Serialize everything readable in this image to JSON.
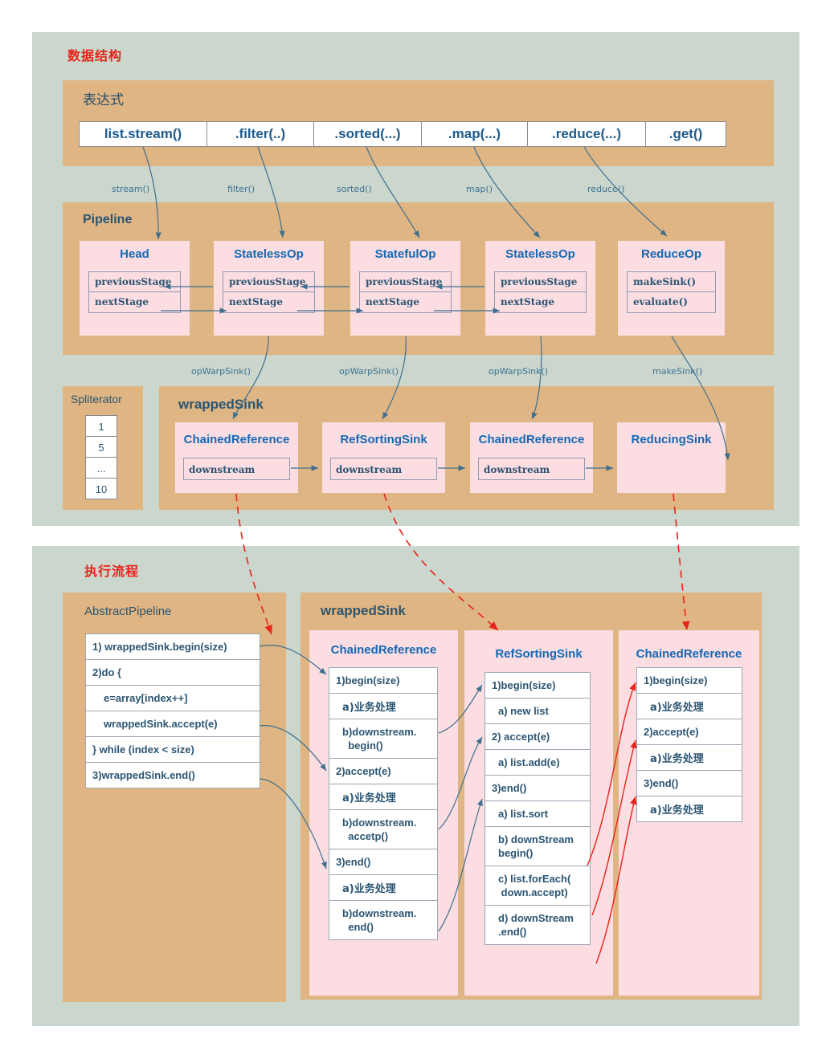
{
  "sections": {
    "data_structure": {
      "title": "数据结构"
    },
    "exec_flow": {
      "title": "执行流程"
    }
  },
  "expression_panel": {
    "title": "表达式",
    "cells": [
      {
        "label": "list.stream()"
      },
      {
        "label": ".filter(..)"
      },
      {
        "label": ".sorted(...)"
      },
      {
        "label": ".map(...)"
      },
      {
        "label": ".reduce(...)"
      },
      {
        "label": ".get()"
      }
    ]
  },
  "connector_labels": {
    "stream": "stream()",
    "filter": "filter()",
    "sorted": "sorted()",
    "map": "map()",
    "reduce": "reduce()",
    "opwrap1": "opWarpSink()",
    "opwrap2": "opWarpSink()",
    "opwrap3": "opWarpSink()",
    "makesink": "makeSink()"
  },
  "pipeline_panel": {
    "title": "Pipeline",
    "stages": [
      {
        "name": "Head",
        "fields": [
          "previousStage",
          "nextStage"
        ]
      },
      {
        "name": "StatelessOp",
        "fields": [
          "previousStage",
          "nextStage"
        ]
      },
      {
        "name": "StatefulOp",
        "fields": [
          "previousStage",
          "nextStage"
        ]
      },
      {
        "name": "StatelessOp",
        "fields": [
          "previousStage",
          "nextStage"
        ]
      },
      {
        "name": "ReduceOp",
        "fields": [
          "makeSink()",
          "evaluate()"
        ]
      }
    ]
  },
  "spliterator_panel": {
    "title": "Spliterator",
    "values": [
      "1",
      "5",
      "...",
      "10"
    ]
  },
  "wrapped_sink_panel": {
    "title": "wrappedSink",
    "sinks": [
      {
        "name": "ChainedReference",
        "field": "downstream"
      },
      {
        "name": "RefSortingSink",
        "field": "downstream"
      },
      {
        "name": "ChainedReference",
        "field": "downstream"
      },
      {
        "name": "ReducingSink",
        "field": ""
      }
    ]
  },
  "abstract_pipeline_panel": {
    "title": "AbstractPipeline",
    "lines": [
      {
        "text": "1) wrappedSink.begin(size)",
        "indent": 0
      },
      {
        "text": "2)do {",
        "indent": 0
      },
      {
        "text": "e=array[index++]",
        "indent": 1
      },
      {
        "text": "wrappedSink.accept(e)",
        "indent": 1
      },
      {
        "text": "} while (index < size)",
        "indent": 0
      },
      {
        "text": "3)wrappedSink.end()",
        "indent": 0
      }
    ]
  },
  "exec_wrapped_sink_panel": {
    "title": "wrappedSink",
    "columns": [
      {
        "name": "ChainedReference",
        "lines": [
          {
            "text": "1)begin(size)",
            "indent": 0,
            "cjk": false,
            "two": false
          },
          {
            "text": "a)业务处理",
            "indent": 1,
            "cjk": true,
            "two": false
          },
          {
            "text": "b)downstream.\n  begin()",
            "indent": 1,
            "cjk": false,
            "two": true
          },
          {
            "text": "2)accept(e)",
            "indent": 0,
            "cjk": false,
            "two": false
          },
          {
            "text": "a)业务处理",
            "indent": 1,
            "cjk": true,
            "two": false
          },
          {
            "text": "b)downstream.\n  accetp()",
            "indent": 1,
            "cjk": false,
            "two": true
          },
          {
            "text": "3)end()",
            "indent": 0,
            "cjk": false,
            "two": false
          },
          {
            "text": "a)业务处理",
            "indent": 1,
            "cjk": true,
            "two": false
          },
          {
            "text": "b)downstream.\n  end()",
            "indent": 1,
            "cjk": false,
            "two": true
          }
        ]
      },
      {
        "name": "RefSortingSink",
        "lines": [
          {
            "text": "1)begin(size)",
            "indent": 0,
            "cjk": false,
            "two": false
          },
          {
            "text": "a) new list",
            "indent": 1,
            "cjk": false,
            "two": false
          },
          {
            "text": "2) accept(e)",
            "indent": 0,
            "cjk": false,
            "two": false
          },
          {
            "text": "a) list.add(e)",
            "indent": 1,
            "cjk": false,
            "two": false
          },
          {
            "text": "3)end()",
            "indent": 0,
            "cjk": false,
            "two": false
          },
          {
            "text": "a) list.sort",
            "indent": 1,
            "cjk": false,
            "two": false
          },
          {
            "text": "b) downStream\nbegin()",
            "indent": 1,
            "cjk": false,
            "two": true
          },
          {
            "text": "c) list.forEach(\n down.accept)",
            "indent": 1,
            "cjk": false,
            "two": true
          },
          {
            "text": "d) downStream\n.end()",
            "indent": 1,
            "cjk": false,
            "two": true
          }
        ]
      },
      {
        "name": "ChainedReference",
        "lines": [
          {
            "text": "1)begin(size)",
            "indent": 0,
            "cjk": false,
            "two": false
          },
          {
            "text": "a)业务处理",
            "indent": 1,
            "cjk": true,
            "two": false
          },
          {
            "text": "2)accept(e)",
            "indent": 0,
            "cjk": false,
            "two": false
          },
          {
            "text": "a)业务处理",
            "indent": 1,
            "cjk": true,
            "two": false
          },
          {
            "text": "3)end()",
            "indent": 0,
            "cjk": false,
            "two": false
          },
          {
            "text": "a)业务处理",
            "indent": 1,
            "cjk": true,
            "two": false
          }
        ]
      }
    ]
  },
  "colors": {
    "gray_panel": "#cbd6cd",
    "tan_panel": "#dfb583",
    "pink_box": "#fbdde2",
    "title_red": "#e8231a",
    "heading_blue": "#1668b3",
    "text_blue": "#2c5572",
    "arrow_blue": "#3f6f8f",
    "arrow_red": "#e8231a"
  }
}
